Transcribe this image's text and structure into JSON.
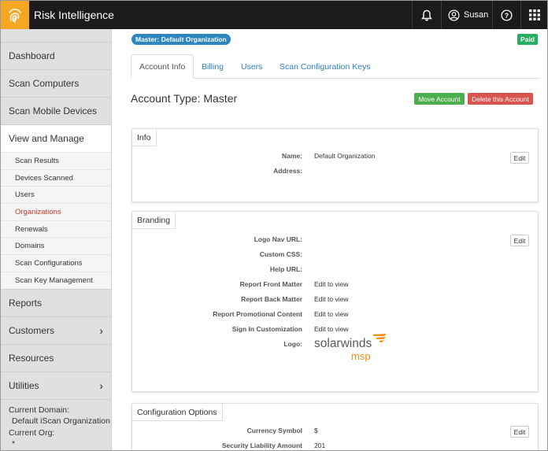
{
  "app": {
    "title": "Risk Intelligence",
    "brand_icon": "fingerprint-icon",
    "accent": "#f5a623"
  },
  "topbar": {
    "notifications_icon": "bell-icon",
    "user_icon": "user-circle-icon",
    "user_name": "Susan",
    "help_icon": "question-circle-icon",
    "apps_icon": "grid-icon"
  },
  "sidebar": {
    "items_top": [
      {
        "label": "Dashboard"
      },
      {
        "label": "Scan Computers"
      },
      {
        "label": "Scan Mobile Devices"
      },
      {
        "label": "View and Manage"
      }
    ],
    "sub_items": [
      {
        "label": "Scan Results"
      },
      {
        "label": "Devices Scanned"
      },
      {
        "label": "Users"
      },
      {
        "label": "Organizations"
      },
      {
        "label": "Renewals"
      },
      {
        "label": "Domains"
      },
      {
        "label": "Scan Configurations"
      },
      {
        "label": "Scan Key Management"
      }
    ],
    "items_bottom": [
      {
        "label": "Reports"
      },
      {
        "label": "Customers",
        "chevron": "›"
      },
      {
        "label": "Resources"
      },
      {
        "label": "Utilities",
        "chevron": "›"
      }
    ],
    "footer": {
      "domain_label": "Current Domain:",
      "domain_value": "Default iScan Organization",
      "org_label": "Current Org:",
      "org_value": "*"
    }
  },
  "main": {
    "master_badge": "Master: Default Organization",
    "paid_badge": "Paid",
    "tabs": [
      {
        "label": "Account Info"
      },
      {
        "label": "Billing"
      },
      {
        "label": "Users"
      },
      {
        "label": "Scan Configuration Keys"
      }
    ],
    "account_type": "Account Type: Master",
    "move_button": "Move Account",
    "delete_button": "Delete this Account",
    "info": {
      "title": "Info",
      "edit": "Edit",
      "fields": [
        {
          "label": "Name:",
          "value": "Default Organization"
        },
        {
          "label": "Address:",
          "value": ""
        }
      ]
    },
    "branding": {
      "title": "Branding",
      "edit": "Edit",
      "fields": [
        {
          "label": "Logo Nav URL:",
          "value": ""
        },
        {
          "label": "Custom CSS:",
          "value": ""
        },
        {
          "label": "Help URL:",
          "value": ""
        },
        {
          "label": "Report Front Matter",
          "value": "Edit to view"
        },
        {
          "label": "Report Back Matter",
          "value": "Edit to view"
        },
        {
          "label": "Report Promotional Content",
          "value": "Edit to view"
        },
        {
          "label": "Sign In Customization",
          "value": "Edit to view"
        },
        {
          "label": "Logo:",
          "value": ""
        }
      ],
      "logo_text": "solarwinds",
      "logo_sub": "msp"
    },
    "config": {
      "title": "Configuration Options",
      "edit": "Edit",
      "fields": [
        {
          "label": "Currency Symbol",
          "value": "$"
        },
        {
          "label": "Security Liability Amount",
          "value": "201"
        }
      ]
    }
  }
}
